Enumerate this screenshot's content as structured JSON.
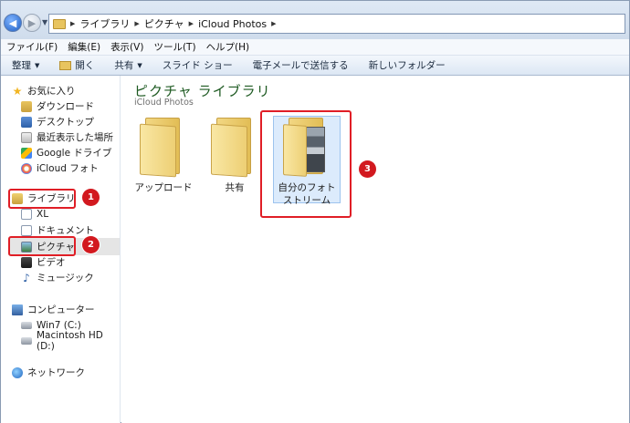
{
  "address": {
    "crumbs": [
      "ライブラリ",
      "ピクチャ",
      "iCloud Photos"
    ]
  },
  "menu": [
    "ファイル(F)",
    "編集(E)",
    "表示(V)",
    "ツール(T)",
    "ヘルプ(H)"
  ],
  "toolbar": {
    "organize": "整理",
    "open": "開く",
    "share": "共有",
    "slideshow": "スライド ショー",
    "email": "電子メールで送信する",
    "new_folder": "新しいフォルダー"
  },
  "nav": {
    "favorites": "お気に入り",
    "downloads": "ダウンロード",
    "desktop": "デスクトップ",
    "recent": "最近表示した場所",
    "gdrive": "Google ドライブ",
    "icloud": "iCloud フォト",
    "libraries": "ライブラリ",
    "xl": "XL",
    "documents": "ドキュメント",
    "pictures": "ピクチャ",
    "videos": "ビデオ",
    "music": "ミュージック",
    "computer": "コンピューター",
    "win7": "Win7 (C:)",
    "mac": "Macintosh HD (D:)",
    "network": "ネットワーク"
  },
  "content": {
    "title": "ピクチャ ライブラリ",
    "subtitle": "iCloud Photos",
    "folders": [
      "アップロード",
      "共有",
      "自分のフォトストリーム"
    ]
  },
  "callouts": [
    "1",
    "2",
    "3"
  ]
}
